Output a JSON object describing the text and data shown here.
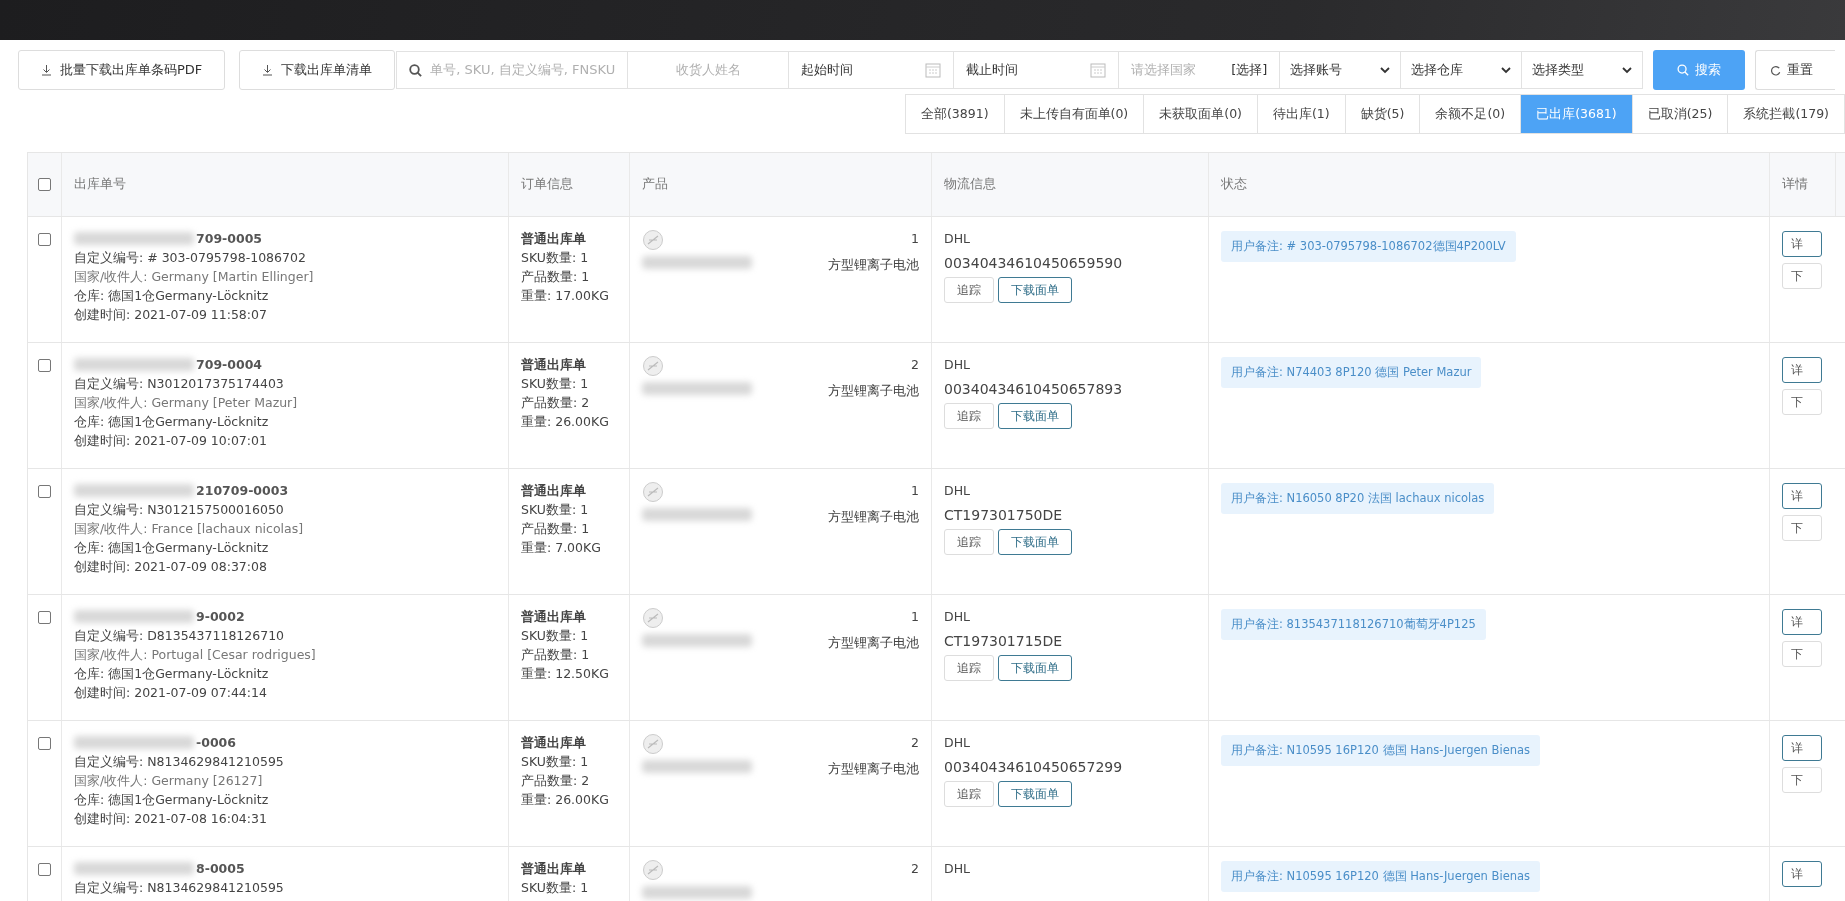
{
  "toolbar": {
    "bulk_download": "批量下载出库单条码PDF",
    "download_list": "下载出库单清单",
    "search": {
      "placeholder": "单号, SKU, 自定义编号, FNSKU"
    },
    "receiver": {
      "placeholder": "收货人姓名"
    },
    "start_time": {
      "placeholder": "起始时间"
    },
    "end_time": {
      "placeholder": "截止时间"
    },
    "country": {
      "placeholder": "请选择国家",
      "action": "[选择]"
    },
    "selects": [
      "选择账号",
      "选择仓库",
      "选择类型"
    ],
    "search_button": "搜索",
    "reset_button": "重置"
  },
  "tabs": [
    {
      "label": "全部(3891)",
      "selected": false
    },
    {
      "label": "未上传自有面单(0)",
      "selected": false
    },
    {
      "label": "未获取面单(0)",
      "selected": false
    },
    {
      "label": "待出库(1)",
      "selected": false
    },
    {
      "label": "缺货(5)",
      "selected": false
    },
    {
      "label": "余额不足(0)",
      "selected": false
    },
    {
      "label": "已出库(3681)",
      "selected": true
    },
    {
      "label": "已取消(25)",
      "selected": false
    },
    {
      "label": "系统拦截(179)",
      "selected": false
    }
  ],
  "table": {
    "columns": [
      "出库单号",
      "订单信息",
      "产品",
      "物流信息",
      "状态",
      "详情"
    ],
    "header_checked": false,
    "rows": [
      {
        "checked": false,
        "order_no": "709-0005",
        "custom_no": "自定义编号: # 303-0795798-1086702",
        "recipient": "国家/收件人: Germany [Martin Ellinger]",
        "warehouse": "仓库: 德国1仓Germany-Löcknitz",
        "created": "创建时间: 2021-07-09 11:58:07",
        "order_type": "普通出库单",
        "sku_count": "SKU数量: 1",
        "product_count": "产品数量: 1",
        "weight": "重量: 17.00KG",
        "qty": "1",
        "product_name": "方型锂离子电池",
        "carrier": "DHL",
        "tracking": "00340434610450659590",
        "actions": [
          "追踪",
          "下载面单"
        ],
        "note": "用户备注: # 303-0795798-1086702德国4P200LV",
        "details": [
          "详",
          "下"
        ]
      },
      {
        "checked": false,
        "order_no": "709-0004",
        "custom_no": "自定义编号: N3012017375174403",
        "recipient": "国家/收件人: Germany [Peter Mazur]",
        "warehouse": "仓库: 德国1仓Germany-Löcknitz",
        "created": "创建时间: 2021-07-09 10:07:01",
        "order_type": "普通出库单",
        "sku_count": "SKU数量: 1",
        "product_count": "产品数量: 2",
        "weight": "重量: 26.00KG",
        "qty": "2",
        "product_name": "方型锂离子电池",
        "carrier": "DHL",
        "tracking": "00340434610450657893",
        "actions": [
          "追踪",
          "下载面单"
        ],
        "note": "用户备注: N74403 8P120 德国 Peter Mazur",
        "details": [
          "详",
          "下"
        ]
      },
      {
        "checked": false,
        "order_no": "210709-0003",
        "custom_no": "自定义编号: N3012157500016050",
        "recipient": "国家/收件人: France [lachaux nicolas]",
        "warehouse": "仓库: 德国1仓Germany-Löcknitz",
        "created": "创建时间: 2021-07-09 08:37:08",
        "order_type": "普通出库单",
        "sku_count": "SKU数量: 1",
        "product_count": "产品数量: 1",
        "weight": "重量: 7.00KG",
        "qty": "1",
        "product_name": "方型锂离子电池",
        "carrier": "DHL",
        "tracking": "CT197301750DE",
        "actions": [
          "追踪",
          "下载面单"
        ],
        "note": "用户备注: N16050 8P20 法国 lachaux nicolas",
        "details": [
          "详",
          "下"
        ]
      },
      {
        "checked": false,
        "order_no": "9-0002",
        "custom_no": "自定义编号: D8135437118126710",
        "recipient": "国家/收件人: Portugal [Cesar rodrigues]",
        "warehouse": "仓库: 德国1仓Germany-Löcknitz",
        "created": "创建时间: 2021-07-09 07:44:14",
        "order_type": "普通出库单",
        "sku_count": "SKU数量: 1",
        "product_count": "产品数量: 1",
        "weight": "重量: 12.50KG",
        "qty": "1",
        "product_name": "方型锂离子电池",
        "carrier": "DHL",
        "tracking": "CT197301715DE",
        "actions": [
          "追踪",
          "下载面单"
        ],
        "note": "用户备注: 8135437118126710葡萄牙4P125",
        "details": [
          "详",
          "下"
        ]
      },
      {
        "checked": false,
        "order_no": "-0006",
        "custom_no": "自定义编号: N8134629841210595",
        "recipient": "国家/收件人: Germany [26127]",
        "warehouse": "仓库: 德国1仓Germany-Löcknitz",
        "created": "创建时间: 2021-07-08 16:04:31",
        "order_type": "普通出库单",
        "sku_count": "SKU数量: 1",
        "product_count": "产品数量: 2",
        "weight": "重量: 26.00KG",
        "qty": "2",
        "product_name": "方型锂离子电池",
        "carrier": "DHL",
        "tracking": "00340434610450657299",
        "actions": [
          "追踪",
          "下载面单"
        ],
        "note": "用户备注: N10595 16P120 德国 Hans-Juergen Bienas",
        "details": [
          "详",
          "下"
        ]
      },
      {
        "checked": false,
        "order_no": "8-0005",
        "custom_no": "自定义编号: N8134629841210595",
        "order_type": "普通出库单",
        "sku_count": "SKU数量: 1",
        "qty": "2",
        "carrier": "DHL",
        "note": "用户备注: N10595 16P120 德国 Hans-Juergen Bienas",
        "details": [
          "详"
        ]
      }
    ]
  }
}
